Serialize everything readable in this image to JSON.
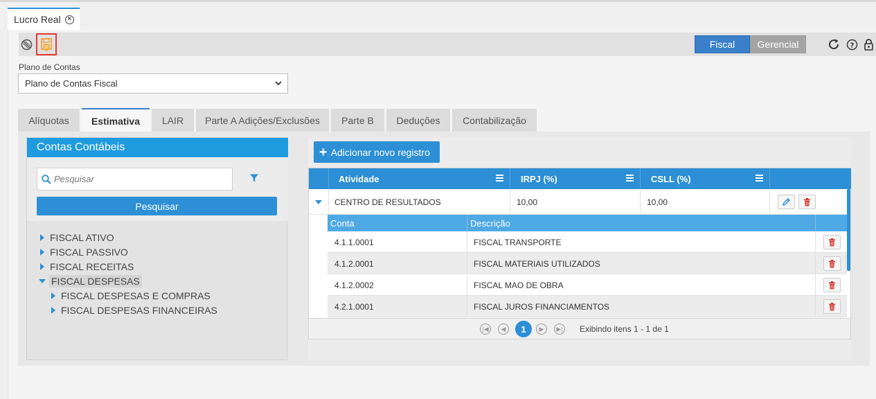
{
  "tab": {
    "title": "Lucro Real"
  },
  "toolbar": {
    "icons": [
      "cancel-icon",
      "save-icon",
      "refresh-icon",
      "help-icon",
      "lock-icon"
    ],
    "fiscal_label": "Fiscal",
    "gerencial_label": "Gerencial",
    "active_button": "Fiscal",
    "accent_color": "#3a7fc9",
    "save_highlight_color": "#e53935"
  },
  "plano": {
    "label": "Plano de Contas",
    "selected": "Plano de Contas Fiscal"
  },
  "tabs": [
    {
      "label": "Alíquotas"
    },
    {
      "label": "Estimativa",
      "active": true
    },
    {
      "label": "LAIR"
    },
    {
      "label": "Parte A Adições/Exclusões"
    },
    {
      "label": "Parte B"
    },
    {
      "label": "Deduções"
    },
    {
      "label": "Contabilização"
    }
  ],
  "contas": {
    "title": "Contas Contábeis",
    "search_placeholder": "Pesquisar",
    "search_button": "Pesquisar",
    "tree": [
      {
        "label": "FISCAL ATIVO",
        "expanded": false
      },
      {
        "label": "FISCAL PASSIVO",
        "expanded": false
      },
      {
        "label": "FISCAL RECEITAS",
        "expanded": false
      },
      {
        "label": "FISCAL DESPESAS",
        "expanded": true,
        "selected": true
      },
      {
        "label": "FISCAL DESPESAS E COMPRAS",
        "level": 2
      },
      {
        "label": "FISCAL DESPESAS FINANCEIRAS",
        "level": 2
      }
    ]
  },
  "grid": {
    "add_button": "Adicionar novo registro",
    "columns": [
      "Atividade",
      "IRPJ (%)",
      "CSLL (%)"
    ],
    "row": {
      "atividade": "CENTRO DE RESULTADOS",
      "irpj": "10,00",
      "csll": "10,00"
    },
    "sub_columns": [
      "Conta",
      "Descrição"
    ],
    "sub_rows": [
      {
        "conta": "4.1.1.0001",
        "descricao": "FISCAL TRANSPORTE"
      },
      {
        "conta": "4.1.2.0001",
        "descricao": "FISCAL MATERIAIS UTILIZADOS"
      },
      {
        "conta": "4.1.2.0002",
        "descricao": "FISCAL MAO DE OBRA"
      },
      {
        "conta": "4.2.1.0001",
        "descricao": "FISCAL JUROS FINANCIAMENTOS"
      }
    ]
  },
  "pager": {
    "current_page": "1",
    "info": "Exibindo itens 1 - 1 de 1"
  }
}
